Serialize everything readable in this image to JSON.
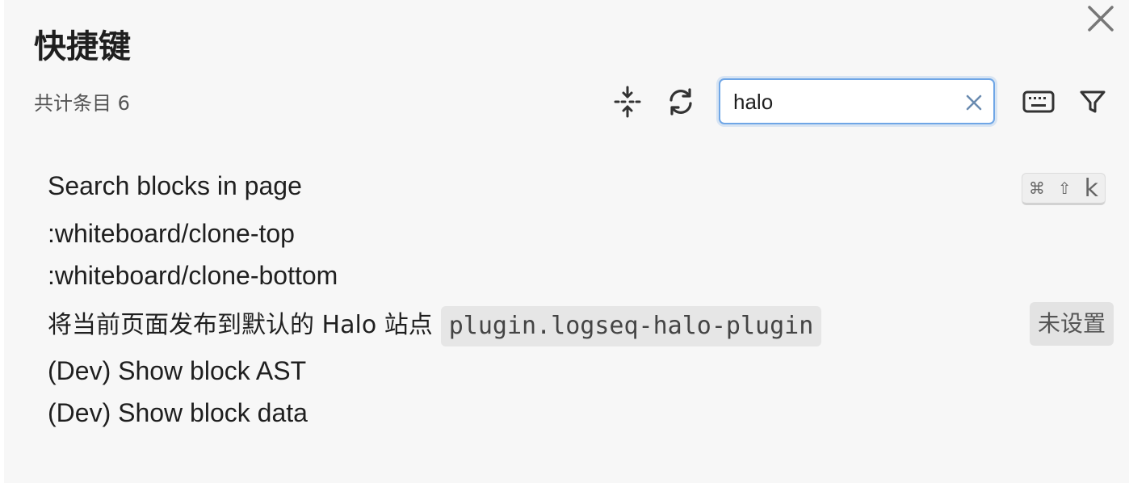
{
  "dialog": {
    "title": "快捷键",
    "count_label": "共计条目 6"
  },
  "toolbar": {
    "icons": [
      "collapse-icon",
      "refresh-icon",
      "keyboard-icon",
      "filter-icon"
    ]
  },
  "search": {
    "value": "halo",
    "placeholder": ""
  },
  "shortcuts": [
    {
      "label": "Search blocks in page",
      "keys": [
        "⌘",
        "⇧",
        "k"
      ]
    },
    {
      "label": ":whiteboard/clone-top"
    },
    {
      "label": ":whiteboard/clone-bottom"
    },
    {
      "label": "将当前页面发布到默认的 Halo 站点",
      "plugin": "plugin.logseq-halo-plugin",
      "status": "未设置"
    },
    {
      "label": "(Dev) Show block AST"
    },
    {
      "label": "(Dev) Show block data"
    }
  ],
  "colors": {
    "panel_bg": "#f7f7f7",
    "search_focus": "#6fa6e6",
    "text": "#1f1f1f"
  }
}
